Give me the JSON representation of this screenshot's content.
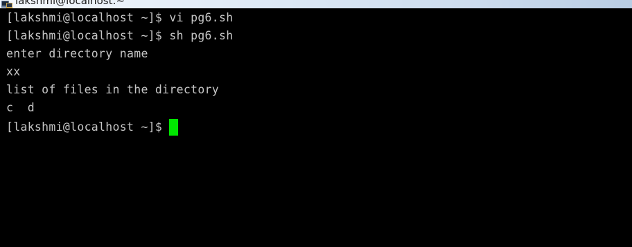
{
  "window": {
    "title": "lakshmi@localhost:~",
    "icon": "putty-terminal-icon"
  },
  "terminal": {
    "lines": [
      "[lakshmi@localhost ~]$ vi pg6.sh",
      "[lakshmi@localhost ~]$ sh pg6.sh",
      "enter directory name",
      "xx",
      "list of files in the directory",
      "c  d"
    ],
    "prompt": "[lakshmi@localhost ~]$ ",
    "cursor_color": "#00e600",
    "background_color": "#000000",
    "text_color": "#c6c6c6"
  }
}
